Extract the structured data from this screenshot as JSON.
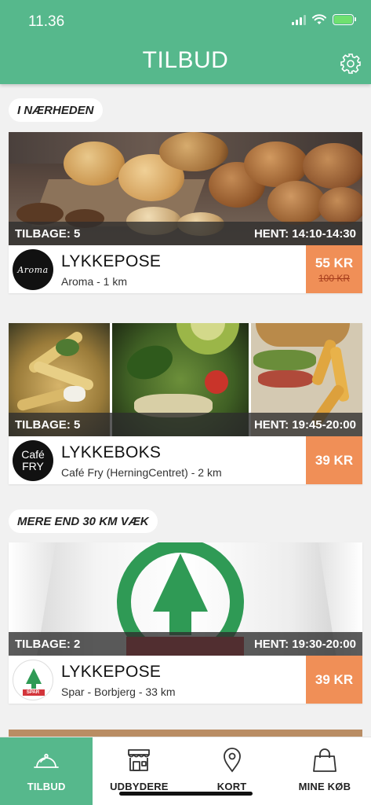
{
  "status_bar": {
    "time": "11.36"
  },
  "header": {
    "title": "TILBUD",
    "settings_icon": "gear-icon"
  },
  "sections": [
    {
      "label": "I NÆRHEDEN"
    },
    {
      "label": "MERE END 30 KM VÆK"
    }
  ],
  "offers": [
    {
      "remaining": "TILBAGE: 5",
      "pickup": "HENT: 14:10-14:30",
      "title": "LYKKEPOSE",
      "subtitle": "Aroma - 1 km",
      "price": "55 KR",
      "old_price": "100 KR",
      "logo_text": "Aroma"
    },
    {
      "remaining": "TILBAGE: 5",
      "pickup": "HENT: 19:45-20:00",
      "title": "LYKKEBOKS",
      "subtitle": "Café Fry (HerningCentret) - 2 km",
      "price": "39 KR",
      "logo_text_1": "Café",
      "logo_text_2": "FRY"
    },
    {
      "remaining": "TILBAGE: 2",
      "pickup": "HENT: 19:30-20:00",
      "title": "LYKKEPOSE",
      "subtitle": "Spar - Borbjerg - 33 km",
      "price": "39 KR",
      "logo_text": "SPAR"
    }
  ],
  "bottom_nav": [
    {
      "label": "TILBUD",
      "icon": "cloche-icon",
      "active": true
    },
    {
      "label": "UDBYDERE",
      "icon": "store-icon",
      "active": false
    },
    {
      "label": "KORT",
      "icon": "map-pin-icon",
      "active": false
    },
    {
      "label": "MINE KØB",
      "icon": "shopping-bag-icon",
      "active": false
    }
  ],
  "colors": {
    "primary": "#56b88c",
    "price": "#f08f57",
    "background": "#f1f1f1"
  }
}
